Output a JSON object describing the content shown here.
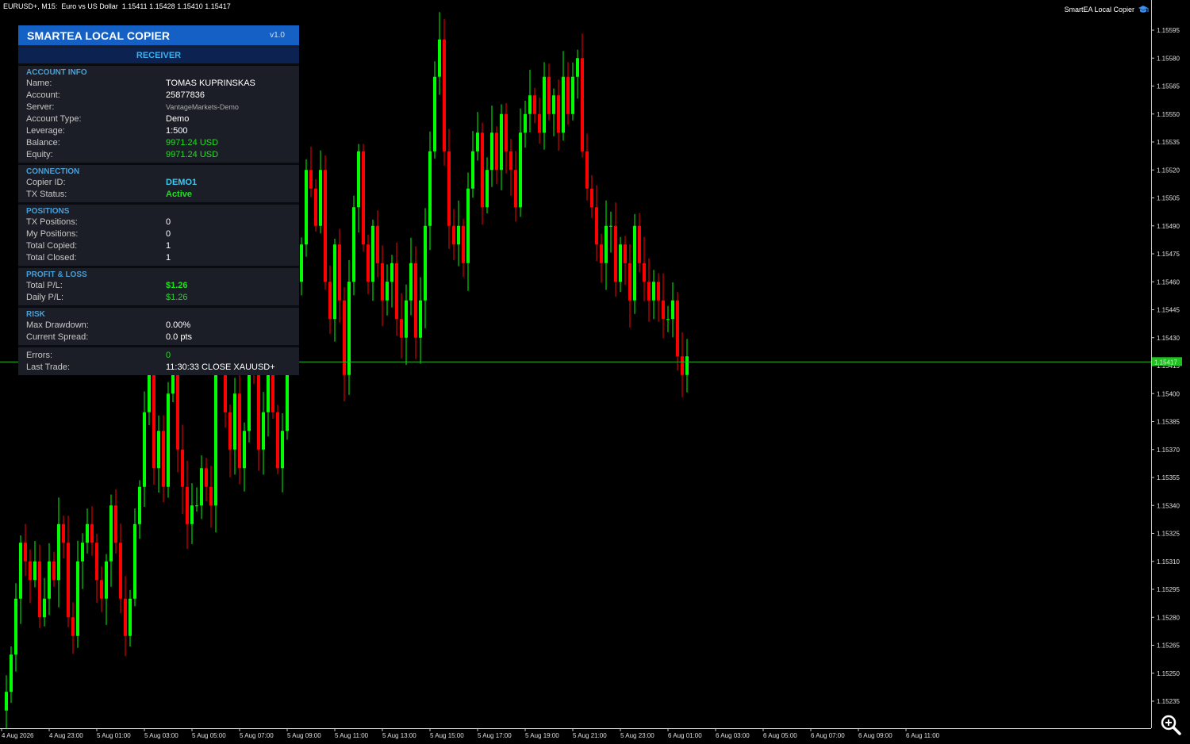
{
  "chart_header": {
    "symbol_line": "EURUSD+, M15:  Euro vs US Dollar  1.15411 1.15428 1.15410 1.15417",
    "ea_label": "SmartEA Local Copier"
  },
  "panel": {
    "title": "SMARTEA LOCAL COPIER",
    "version": "v1.0",
    "mode": "RECEIVER",
    "account_info": {
      "title": "ACCOUNT INFO",
      "name_label": "Name:",
      "name": "TOMAS KUPRINSKAS",
      "account_label": "Account:",
      "account": "25877836",
      "server_label": "Server:",
      "server": "VantageMarkets-Demo",
      "type_label": "Account Type:",
      "type": "Demo",
      "leverage_label": "Leverage:",
      "leverage": "1:500",
      "balance_label": "Balance:",
      "balance": "9971.24 USD",
      "equity_label": "Equity:",
      "equity": "9971.24 USD"
    },
    "connection": {
      "title": "CONNECTION",
      "copier_label": "Copier ID:",
      "copier": "DEMO1",
      "status_label": "TX Status:",
      "status": "Active"
    },
    "positions": {
      "title": "POSITIONS",
      "tx_label": "TX Positions:",
      "tx": "0",
      "my_label": "My Positions:",
      "my": "0",
      "copied_label": "Total Copied:",
      "copied": "1",
      "closed_label": "Total Closed:",
      "closed": "1"
    },
    "pnl": {
      "title": "PROFIT & LOSS",
      "total_label": "Total P/L:",
      "total": "$1.26",
      "daily_label": "Daily P/L:",
      "daily": "$1.26"
    },
    "risk": {
      "title": "RISK",
      "drawdown_label": "Max Drawdown:",
      "drawdown": "0.00%",
      "spread_label": "Current Spread:",
      "spread": "0.0 pts"
    },
    "misc": {
      "errors_label": "Errors:",
      "errors": "0",
      "last_trade_label": "Last Trade:",
      "last_trade": "11:30:33 CLOSE XAUUSD+"
    }
  },
  "colors": {
    "bull": "#00ff00",
    "bear": "#ff0000",
    "current_price_line": "#20c020",
    "panel_header": "#1460c4"
  },
  "chart_data": {
    "type": "candlestick",
    "y_ticks": [
      "1.15595",
      "1.15580",
      "1.15565",
      "1.15550",
      "1.15535",
      "1.15520",
      "1.15505",
      "1.15490",
      "1.15475",
      "1.15460",
      "1.15445",
      "1.15430",
      "1.15415",
      "1.15400",
      "1.15385",
      "1.15370",
      "1.15355",
      "1.15340",
      "1.15325",
      "1.15310",
      "1.15295",
      "1.15280",
      "1.15265",
      "1.15250",
      "1.15235"
    ],
    "x_ticks": [
      "4 Aug 2026",
      "4 Aug 23:00",
      "5 Aug 01:00",
      "5 Aug 03:00",
      "5 Aug 05:00",
      "5 Aug 07:00",
      "5 Aug 09:00",
      "5 Aug 11:00",
      "5 Aug 13:00",
      "5 Aug 15:00",
      "5 Aug 17:00",
      "5 Aug 19:00",
      "5 Aug 21:00",
      "5 Aug 23:00",
      "6 Aug 01:00",
      "6 Aug 03:00",
      "6 Aug 05:00",
      "6 Aug 07:00",
      "6 Aug 09:00",
      "6 Aug 11:00"
    ],
    "ylim": [
      1.15229,
      1.15609
    ],
    "current_price": 1.15417,
    "current_price_label": "1.15417",
    "closes": [
      1.1524,
      1.1526,
      1.1529,
      1.1532,
      1.1531,
      1.153,
      1.1531,
      1.1528,
      1.1529,
      1.1531,
      1.153,
      1.1533,
      1.1532,
      1.1528,
      1.1527,
      1.1531,
      1.1532,
      1.1533,
      1.1532,
      1.153,
      1.1529,
      1.1531,
      1.1534,
      1.1532,
      1.1529,
      1.1527,
      1.1529,
      1.1533,
      1.1535,
      1.1539,
      1.1541,
      1.1536,
      1.1538,
      1.1535,
      1.154,
      1.1541,
      1.1537,
      1.1535,
      1.1533,
      1.1534,
      1.1534,
      1.1536,
      1.1535,
      1.1534,
      1.1542,
      1.1545,
      1.1539,
      1.1537,
      1.154,
      1.1536,
      1.1538,
      1.1544,
      1.1541,
      1.1537,
      1.1539,
      1.1542,
      1.1539,
      1.1536,
      1.1538,
      1.1542,
      1.1545,
      1.1546,
      1.1548,
      1.1552,
      1.1551,
      1.1549,
      1.1552,
      1.1546,
      1.1544,
      1.1548,
      1.1545,
      1.1541,
      1.1546,
      1.155,
      1.1553,
      1.1548,
      1.1546,
      1.1549,
      1.1547,
      1.1545,
      1.1546,
      1.1547,
      1.1544,
      1.1543,
      1.1545,
      1.1547,
      1.1543,
      1.1545,
      1.1549,
      1.1553,
      1.1557,
      1.1559,
      1.1553,
      1.1549,
      1.1548,
      1.1549,
      1.1547,
      1.1551,
      1.1553,
      1.1554,
      1.155,
      1.1552,
      1.1554,
      1.1552,
      1.1555,
      1.1553,
      1.1552,
      1.155,
      1.1554,
      1.1555,
      1.1556,
      1.1555,
      1.1554,
      1.1557,
      1.1555,
      1.1556,
      1.1554,
      1.1557,
      1.1555,
      1.1557,
      1.1558,
      1.1553,
      1.1551,
      1.155,
      1.1548,
      1.1547,
      1.1549,
      1.1549,
      1.1546,
      1.1548,
      1.1547,
      1.1545,
      1.1549,
      1.1547,
      1.1546,
      1.1545,
      1.1546,
      1.1545,
      1.1544,
      1.1544,
      1.1545,
      1.1542,
      1.1541,
      1.1542
    ]
  }
}
